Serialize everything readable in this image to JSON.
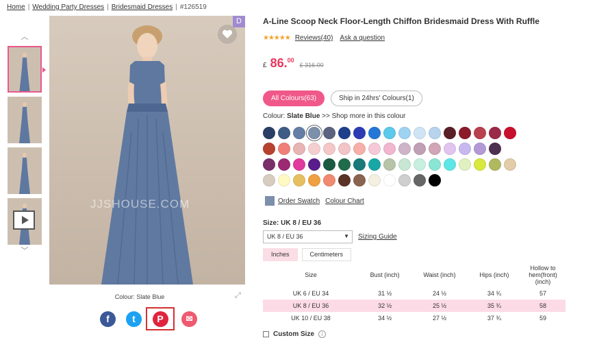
{
  "breadcrumb": {
    "home": "Home",
    "sep": "|",
    "wedding_party": "Wedding Party Dresses",
    "bridesmaid": "Bridesmaid Dresses",
    "id": "#126519"
  },
  "gallery": {
    "badge": "D",
    "watermark": "JJSHOUSE.COM",
    "colour_caption": "Colour: Slate Blue"
  },
  "share": {
    "facebook": "f",
    "twitter": "t",
    "pinterest": "P",
    "email": "✉"
  },
  "product": {
    "title": "A-Line Scoop Neck Floor-Length Chiffon Bridesmaid Dress With Ruffle",
    "stars": "★★★★★",
    "reviews": "Reviews(40)",
    "ask": "Ask a question",
    "currency": "£",
    "price_main": "86.",
    "price_dec": "00",
    "old_price": "£ 316.00"
  },
  "filters": {
    "all": "All Colours(63)",
    "ship": "Ship in 24hrs' Colours(1)"
  },
  "colour": {
    "label": "Colour:",
    "value": "Slate Blue",
    "more": ">> Shop more in this colour"
  },
  "swatch_rows": [
    [
      "#2b3e66",
      "#3f5c85",
      "#647ea6",
      "#7c8fab",
      "#5c6380",
      "#1f3f8c",
      "#2d3bb3",
      "#2477d6",
      "#5cc9ea",
      "#9fd3f2",
      "#cfe4f5",
      "#b7d3ee",
      "#5a1f26",
      "#8c1a2b",
      "#b9404f",
      "#9b2a48",
      "#c8102e"
    ],
    [
      "#b6422f",
      "#f07f7a",
      "#e8b4b4",
      "#f5cfd0",
      "#f4c8c8",
      "#f2c4c8",
      "#f7b0a9",
      "#f5c9d8",
      "#f2b6cf",
      "#cdb4c9",
      "#c0a0b4",
      "#d1a5b5",
      "#e2c4f0",
      "#c8b8f0",
      "#b39ad6",
      "#4e3050"
    ],
    [
      "#7a2f6b",
      "#9c2a73",
      "#e03a9e",
      "#5a1d8c",
      "#1a5a44",
      "#1f6b4c",
      "#1a7a7a",
      "#18a6a6",
      "#b8c4a8",
      "#c8e6d4",
      "#c8f0e0",
      "#8ae6d4",
      "#5ce6e6",
      "#e0f0c0",
      "#d8e83c",
      "#b0b860",
      "#e2cda8"
    ],
    [
      "#d6ccc0",
      "#fff9c4",
      "#e6c060",
      "#f0a040",
      "#f08a70",
      "#5a3226",
      "#8a6450",
      "#f4f0e0",
      "#ffffff",
      "#cfcfcf",
      "#666666",
      "#000000"
    ]
  ],
  "selected_swatch": "#7c8fab",
  "swatch_links": {
    "order": "Order Swatch",
    "chart": "Colour Chart"
  },
  "size": {
    "label": "Size:",
    "value": "UK 8 / EU 36",
    "selected": "UK 8 / EU 36",
    "guide": "Sizing Guide",
    "unit_inches": "Inches",
    "unit_cm": "Centimeters"
  },
  "size_table": {
    "headers": [
      "Size",
      "Bust (inch)",
      "Waist (inch)",
      "Hips (inch)",
      "Hollow to hem(front) (inch)"
    ],
    "rows": [
      [
        "UK 6 / EU 34",
        "31 ½",
        "24 ½",
        "34 ¾",
        "57"
      ],
      [
        "UK 8 / EU 36",
        "32 ½",
        "25 ½",
        "35 ¾",
        "58"
      ],
      [
        "UK 10 / EU 38",
        "34 ½",
        "27 ½",
        "37 ¾",
        "59"
      ]
    ],
    "highlight_index": 1
  },
  "custom_size": "Custom Size"
}
